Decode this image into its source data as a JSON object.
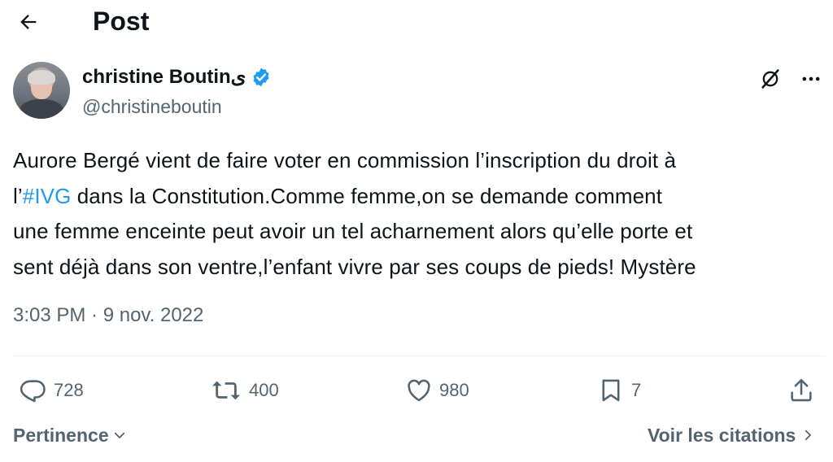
{
  "header": {
    "title": "Post",
    "back_icon": "arrow-left-icon"
  },
  "author": {
    "name": "christine Boutinی",
    "handle": "@christineboutin",
    "verified_icon": "verified-badge-icon",
    "verified_color": "#1d9bf0"
  },
  "tweet": {
    "text_before": "Aurore Bergé vient de faire voter en commission l’inscription du droit à\nl’",
    "hashtag": "#IVG",
    "text_after": " dans la Constitution.Comme femme,on se demande comment\nune femme enceinte peut avoir un tel acharnement alors qu’elle porte et\nsent déjà dans  son ventre,l’enfant vivre par ses coups de pieds! Mystère",
    "timestamp": "3:03 PM · 9 nov. 2022"
  },
  "actions": {
    "replies": "728",
    "reposts": "400",
    "likes": "980",
    "bookmarks": "7"
  },
  "footer": {
    "sort_label": "Pertinence",
    "quotes_label": "Voir les citations"
  },
  "colors": {
    "text": "#0f1419",
    "secondary": "#536471",
    "accent": "#1d9bf0"
  }
}
